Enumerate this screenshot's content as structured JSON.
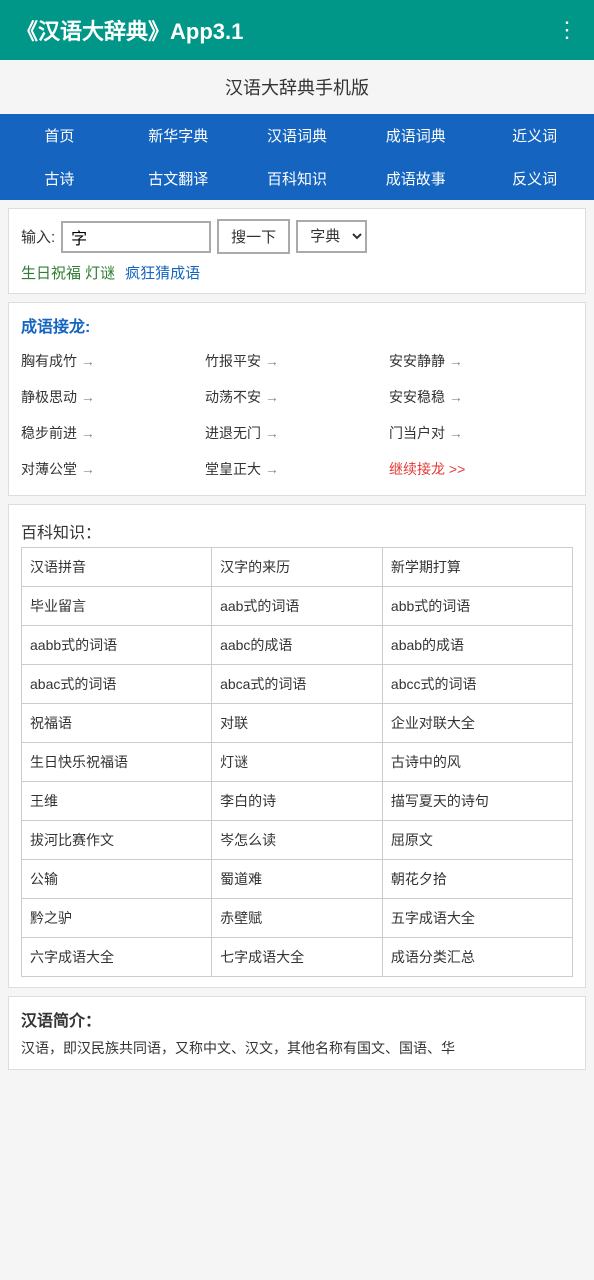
{
  "header": {
    "title": "《汉语大辞典》App3.1",
    "menu_icon": "⋮"
  },
  "subtitle": "汉语大辞典手机版",
  "nav": {
    "row1": [
      {
        "label": "首页"
      },
      {
        "label": "新华字典"
      },
      {
        "label": "汉语词典"
      },
      {
        "label": "成语词典"
      },
      {
        "label": "近义词"
      }
    ],
    "row2": [
      {
        "label": "古诗"
      },
      {
        "label": "古文翻译"
      },
      {
        "label": "百科知识"
      },
      {
        "label": "成语故事"
      },
      {
        "label": "反义词"
      }
    ]
  },
  "search": {
    "label": "输入:",
    "input_value": "字",
    "button_label": "搜一下",
    "select_label": "字典",
    "link1": "生日祝福 灯谜",
    "link2": "疯狂猜成语"
  },
  "chengyu": {
    "title": "成语接龙:",
    "items": [
      {
        "text": "胸有成竹",
        "arrow": "→"
      },
      {
        "text": "竹报平安",
        "arrow": "→"
      },
      {
        "text": "安安静静",
        "arrow": "→"
      },
      {
        "text": "静极思动",
        "arrow": "→"
      },
      {
        "text": "动荡不安",
        "arrow": "→"
      },
      {
        "text": "安安稳稳",
        "arrow": "→"
      },
      {
        "text": "稳步前进",
        "arrow": "→"
      },
      {
        "text": "进退无门",
        "arrow": "→"
      },
      {
        "text": "门当户对",
        "arrow": "→"
      },
      {
        "text": "对薄公堂",
        "arrow": "→"
      },
      {
        "text": "堂皇正大",
        "arrow": "→"
      },
      {
        "text": "继续接龙 >>",
        "is_link": true
      }
    ]
  },
  "baike": {
    "title": "百科知识：",
    "rows": [
      [
        "汉语拼音",
        "汉字的来历",
        "新学期打算"
      ],
      [
        "毕业留言",
        "aab式的词语",
        "abb式的词语"
      ],
      [
        "aabb式的词语",
        "aabc的成语",
        "abab的成语"
      ],
      [
        "abac式的词语",
        "abca式的词语",
        "abcc式的词语"
      ],
      [
        "祝福语",
        "对联",
        "企业对联大全"
      ],
      [
        "生日快乐祝福语",
        "灯谜",
        "古诗中的风"
      ],
      [
        "王维",
        "李白的诗",
        "描写夏天的诗句"
      ],
      [
        "拔河比赛作文",
        "岑怎么读",
        "屈原文"
      ],
      [
        "公输",
        "蜀道难",
        "朝花夕拾"
      ],
      [
        "黔之驴",
        "赤壁赋",
        "五字成语大全"
      ],
      [
        "六字成语大全",
        "七字成语大全",
        "成语分类汇总"
      ]
    ]
  },
  "description": {
    "title": "汉语简介：",
    "text": "汉语，即汉民族共同语，又称中文、汉文，其他名称有国文、国语、华"
  }
}
